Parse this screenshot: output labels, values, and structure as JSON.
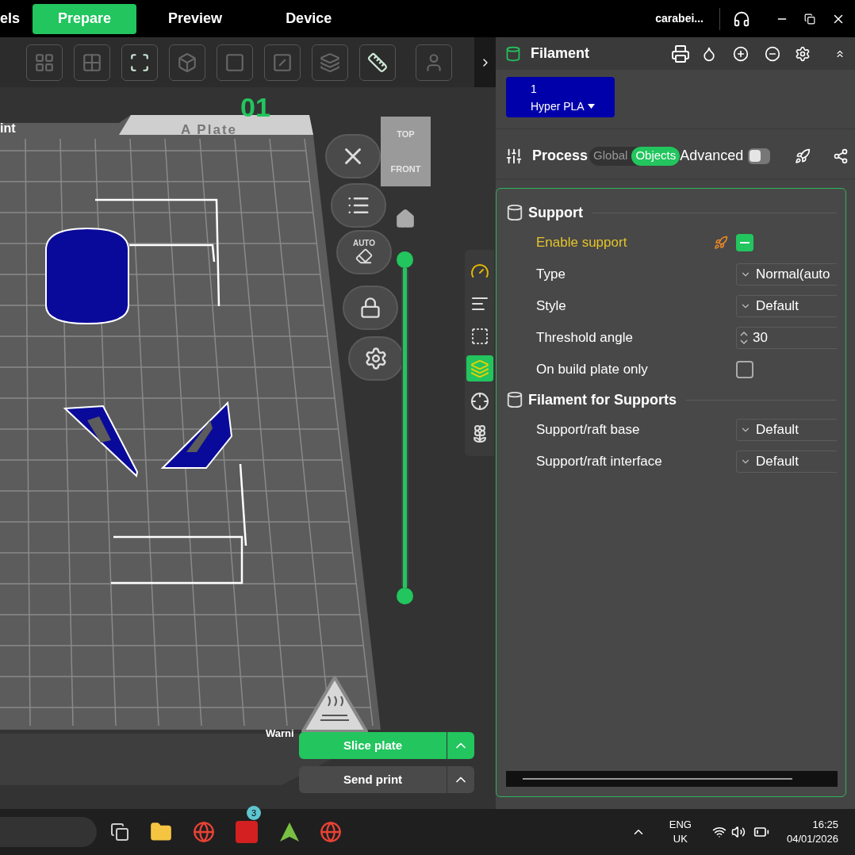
{
  "top_bar": {
    "tabs": [
      {
        "label": "els",
        "selected": false
      },
      {
        "label": "Prepare",
        "selected": true
      },
      {
        "label": "Preview",
        "selected": false
      },
      {
        "label": "Device",
        "selected": false
      }
    ],
    "user": "carabei..."
  },
  "viewport": {
    "plate_number": "01",
    "plate_name": "A Plate",
    "plate_tab_left": "int",
    "view_cube": [
      "TOP",
      "FRONT"
    ],
    "auto_label": "AUTO",
    "warning": "Warni",
    "layer_slider": {
      "level": 1
    }
  },
  "actions": [
    {
      "label": "Slice plate",
      "primary": true
    },
    {
      "label": "Send print",
      "primary": false
    }
  ],
  "filament": {
    "title": "Filament",
    "slots": [
      {
        "index": "1",
        "name": "Hyper PLA",
        "color": "#0000aa"
      }
    ]
  },
  "process": {
    "title": "Process",
    "modes": [
      {
        "label": "Global",
        "selected": false
      },
      {
        "label": "Objects",
        "selected": true
      }
    ],
    "advanced": {
      "label": "Advanced",
      "on": false
    }
  },
  "sections": [
    {
      "title": "Support",
      "rows": [
        {
          "label": "Enable support",
          "kind": "check",
          "checked": true,
          "modified": true
        },
        {
          "label": "Type",
          "kind": "select",
          "value": "Normal(auto",
          "modified": false
        },
        {
          "label": "Style",
          "kind": "select",
          "value": "Default",
          "modified": false
        },
        {
          "label": "Threshold angle",
          "kind": "spin",
          "value": "30",
          "modified": false
        },
        {
          "label": "On build plate only",
          "kind": "check",
          "checked": false,
          "modified": false
        }
      ]
    },
    {
      "title": "Filament for Supports",
      "rows": [
        {
          "label": "Support/raft base",
          "kind": "select",
          "value": "Default",
          "modified": false
        },
        {
          "label": "Support/raft interface",
          "kind": "select",
          "value": "Default",
          "modified": false
        }
      ]
    }
  ],
  "taskbar": {
    "badge": "3",
    "language": "ENG",
    "region": "UK",
    "time": "16:25",
    "date": "04/01/2026"
  }
}
